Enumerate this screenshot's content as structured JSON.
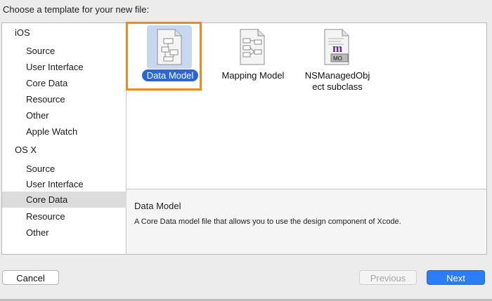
{
  "heading": "Choose a template for your new file:",
  "sidebar": {
    "groups": [
      {
        "label": "iOS",
        "items": [
          "Source",
          "User Interface",
          "Core Data",
          "Resource",
          "Other",
          "Apple Watch"
        ]
      },
      {
        "label": "OS X",
        "items": [
          "Source",
          "User Interface",
          "Core Data",
          "Resource",
          "Other"
        ]
      }
    ],
    "selected": "OS X / Core Data"
  },
  "templates": [
    {
      "label": "Data Model",
      "icon": "data-model-icon",
      "selected": true
    },
    {
      "label": "Mapping Model",
      "icon": "mapping-model-icon",
      "selected": false
    },
    {
      "label": "NSManagedObject subclass",
      "label_line1": "NSManagedObj",
      "label_line2": "ect subclass",
      "icon": "managed-object-icon",
      "badge_m": "m",
      "badge_mo": "MO",
      "selected": false
    }
  ],
  "description": {
    "title": "Data Model",
    "text": "A Core Data model file that allows you to use the design component of Xcode."
  },
  "buttons": {
    "cancel": "Cancel",
    "previous": "Previous",
    "next": "Next"
  },
  "colors": {
    "selection_blue": "#2a66d6",
    "highlight_orange": "#f08a1c",
    "next_button": "#2b7df5"
  }
}
